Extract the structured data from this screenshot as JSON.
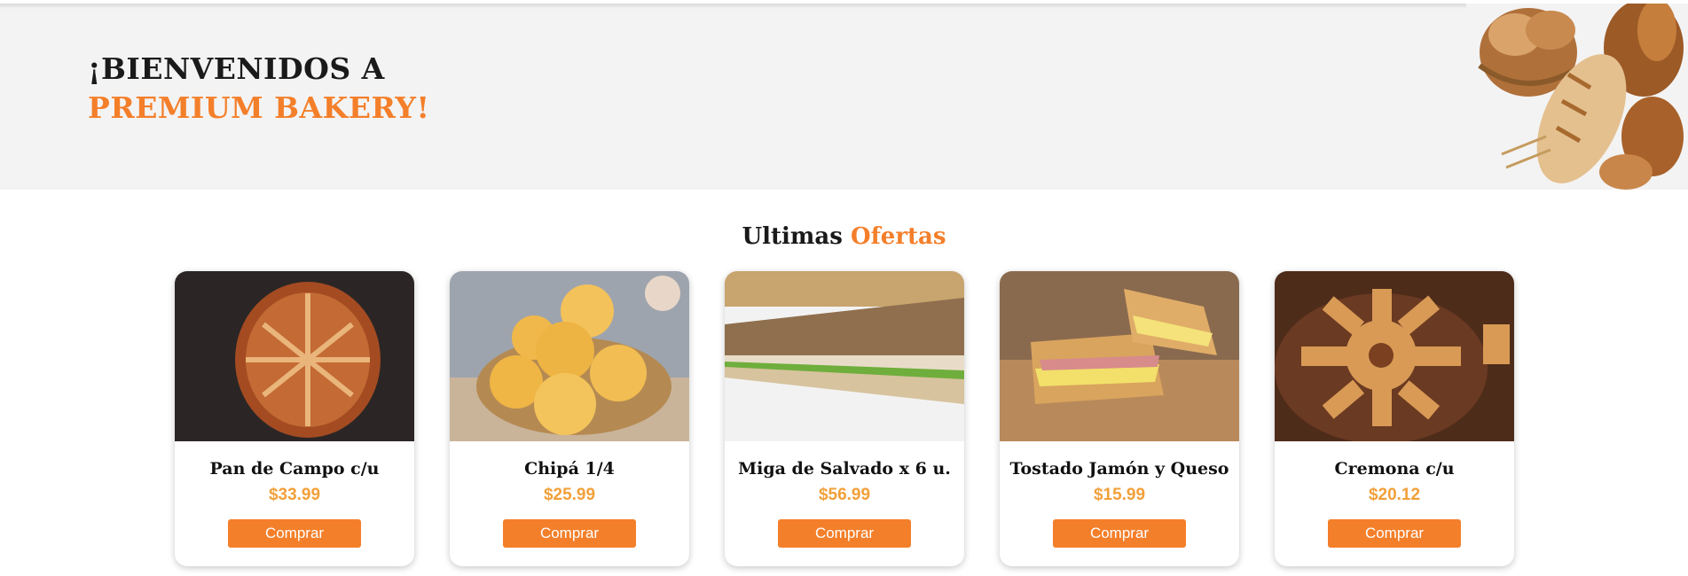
{
  "hero": {
    "line1": "¡BIENVENIDOS A",
    "line2": "PREMIUM BAKERY!"
  },
  "offers": {
    "title_prefix": "Ultimas",
    "title_accent": "Ofertas"
  },
  "products": [
    {
      "name": "Pan de Campo c/u",
      "price": "$33.99",
      "button": "Comprar"
    },
    {
      "name": "Chipá 1/4",
      "price": "$25.99",
      "button": "Comprar"
    },
    {
      "name": "Miga de Salvado x 6 u.",
      "price": "$56.99",
      "button": "Comprar"
    },
    {
      "name": "Tostado Jamón y Queso",
      "price": "$15.99",
      "button": "Comprar"
    },
    {
      "name": "Cremona c/u",
      "price": "$20.12",
      "button": "Comprar"
    }
  ],
  "colors": {
    "accent": "#f47f2a",
    "price": "#f2a03a",
    "hero_bg": "#f3f3f3"
  }
}
